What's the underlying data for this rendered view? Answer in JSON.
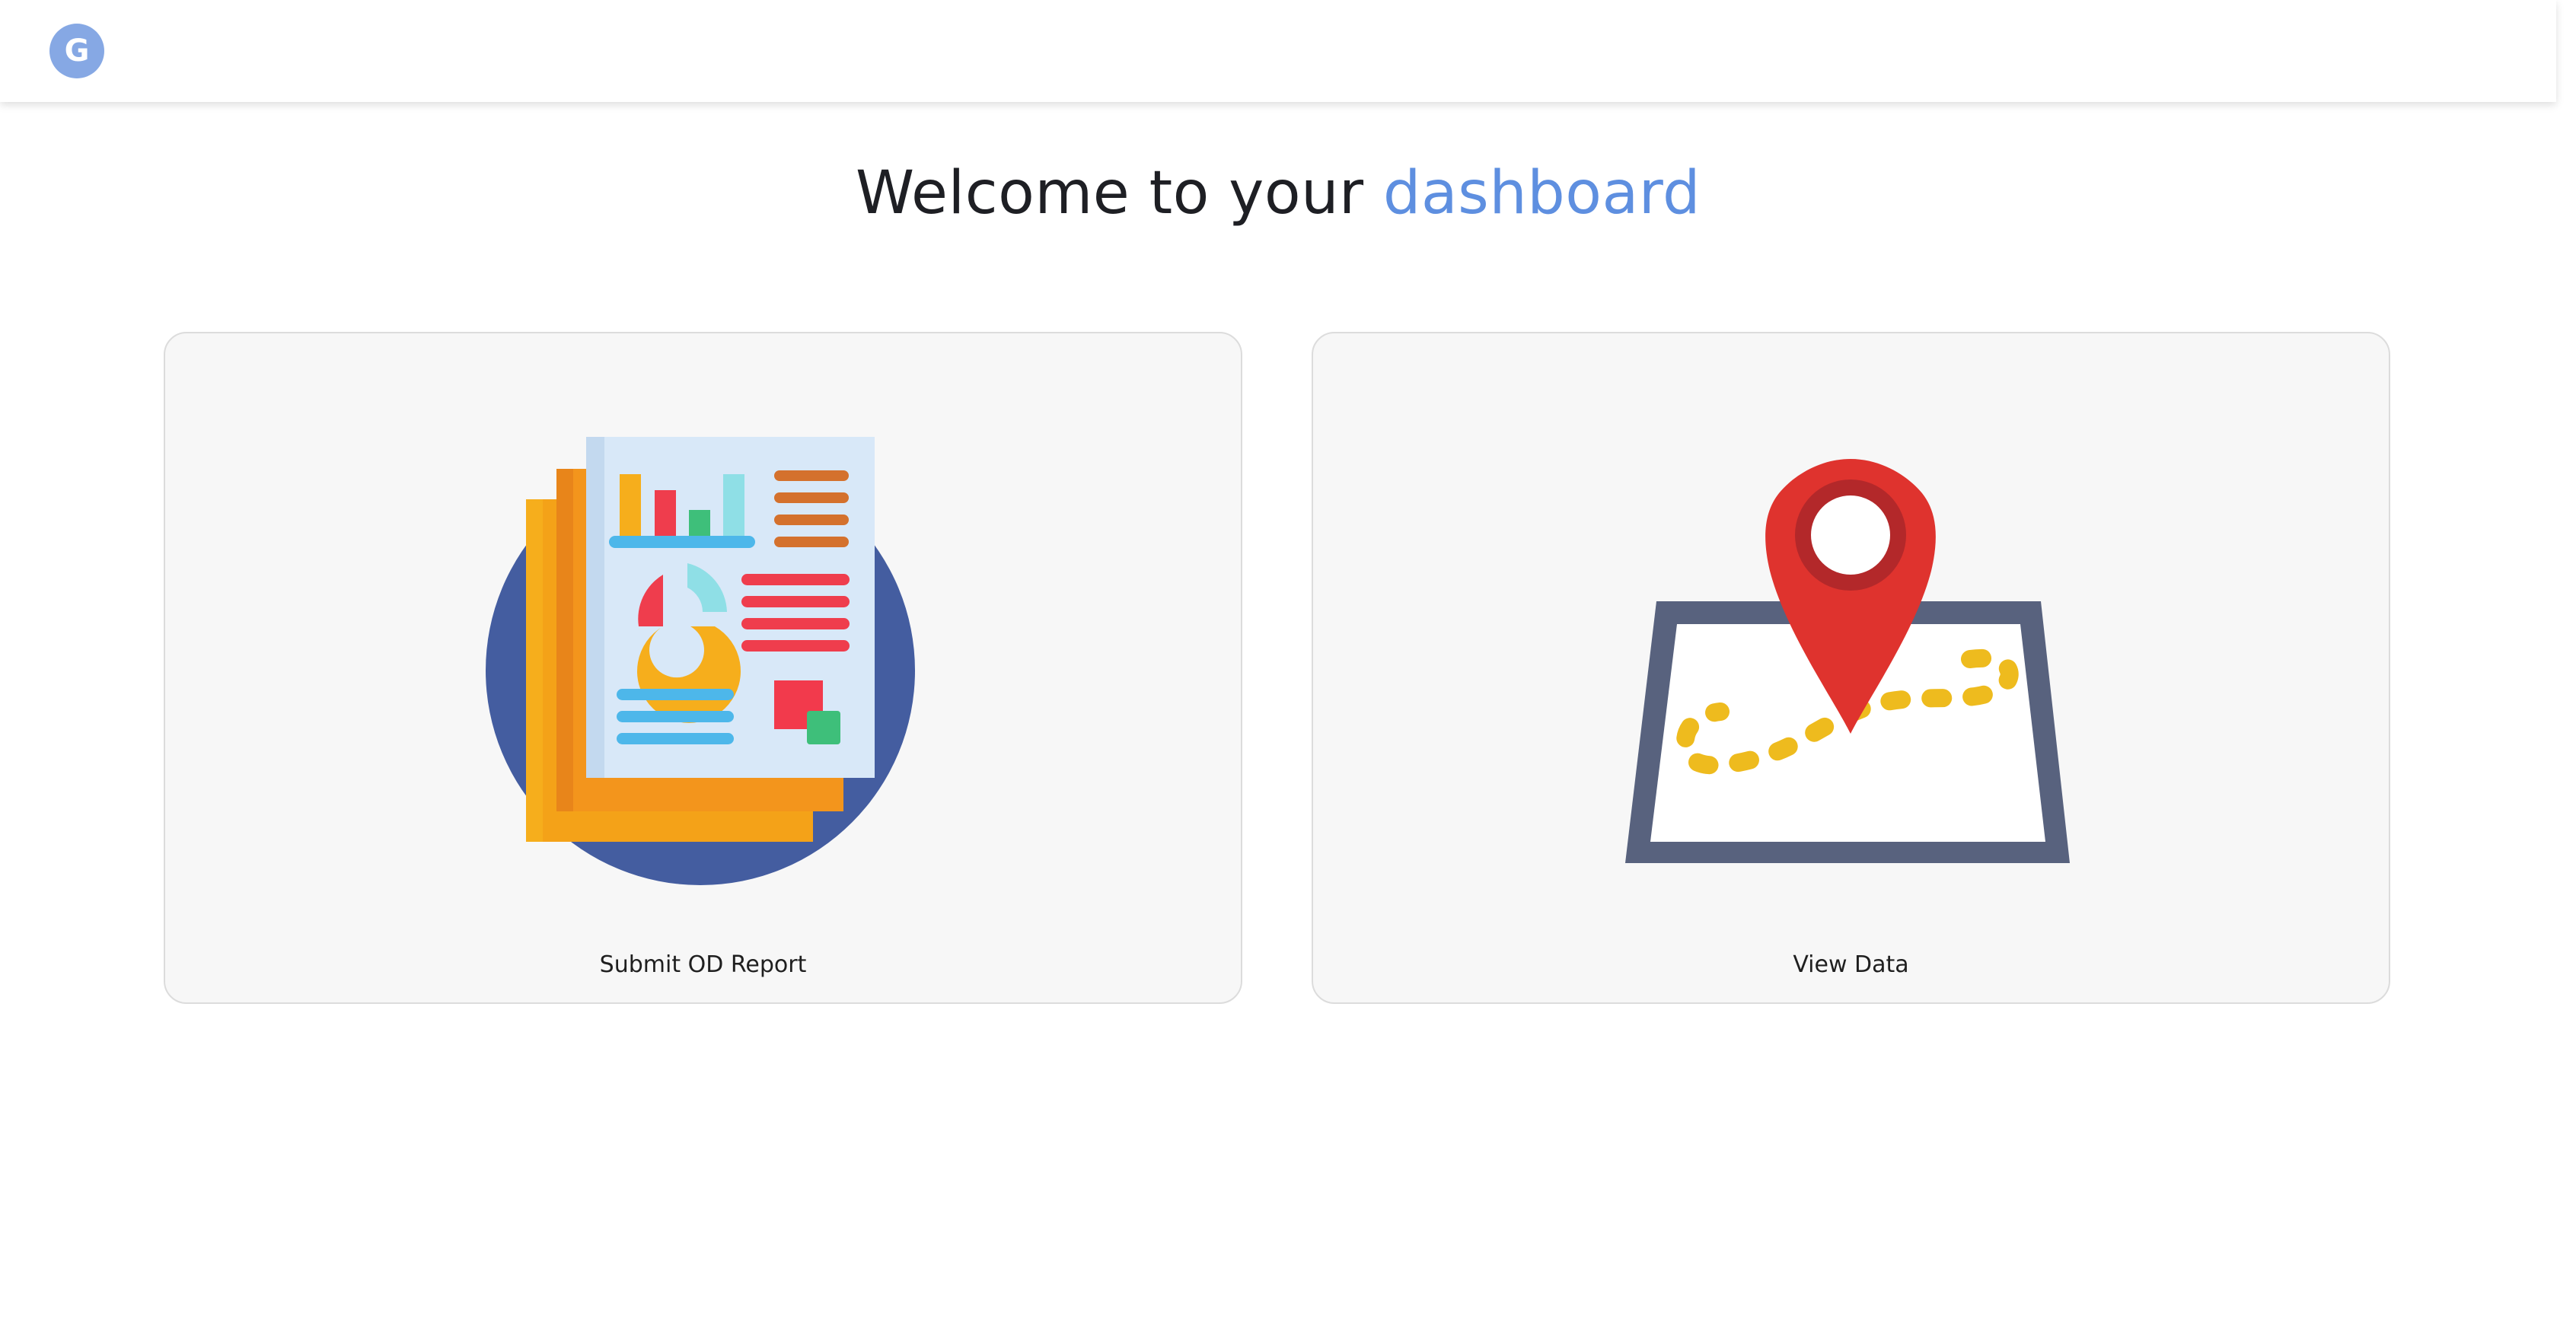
{
  "header": {
    "avatar_letter": "G"
  },
  "welcome": {
    "prefix": "Welcome to your ",
    "highlight": "dashboard"
  },
  "cards": [
    {
      "label": "Submit OD Report",
      "icon": "report-document-icon"
    },
    {
      "label": "View Data",
      "icon": "map-location-pin-icon"
    }
  ],
  "colors": {
    "accent": "#5e8fe0",
    "avatar": "#86a8e4",
    "card_background": "#f7f7f7"
  }
}
